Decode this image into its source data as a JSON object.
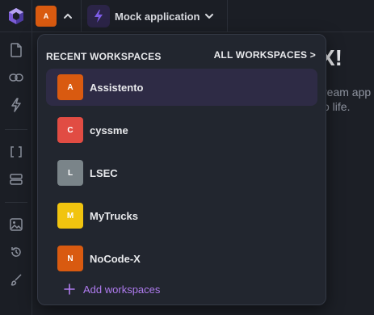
{
  "topbar": {
    "logo_icon": "app-logo-hexagon",
    "current_workspace_initial": "A",
    "current_workspace_color": "#d95a10",
    "app_name": "Mock application"
  },
  "background": {
    "title_fragment": "X!",
    "line1_fragment": "ream app",
    "line2_fragment": "o life."
  },
  "sidebar": {
    "icons": [
      "file-icon",
      "link-icon",
      "lightning-icon",
      "brackets-icon",
      "database-icon",
      "image-icon",
      "history-icon",
      "brush-icon"
    ]
  },
  "dropdown": {
    "title": "RECENT WORKSPACES",
    "all_label": "ALL WORKSPACES >",
    "workspaces": [
      {
        "initial": "A",
        "name": "Assistento",
        "color": "#d95a10",
        "active": true
      },
      {
        "initial": "C",
        "name": "cyssme",
        "color": "#e14c43",
        "active": false
      },
      {
        "initial": "L",
        "name": "LSEC",
        "color": "#7a8489",
        "active": false
      },
      {
        "initial": "M",
        "name": "MyTrucks",
        "color": "#f1c40f",
        "active": false
      },
      {
        "initial": "N",
        "name": "NoCode-X",
        "color": "#d95a10",
        "active": false
      }
    ],
    "add_label": "Add workspaces",
    "accent_color": "#b07cf0"
  }
}
